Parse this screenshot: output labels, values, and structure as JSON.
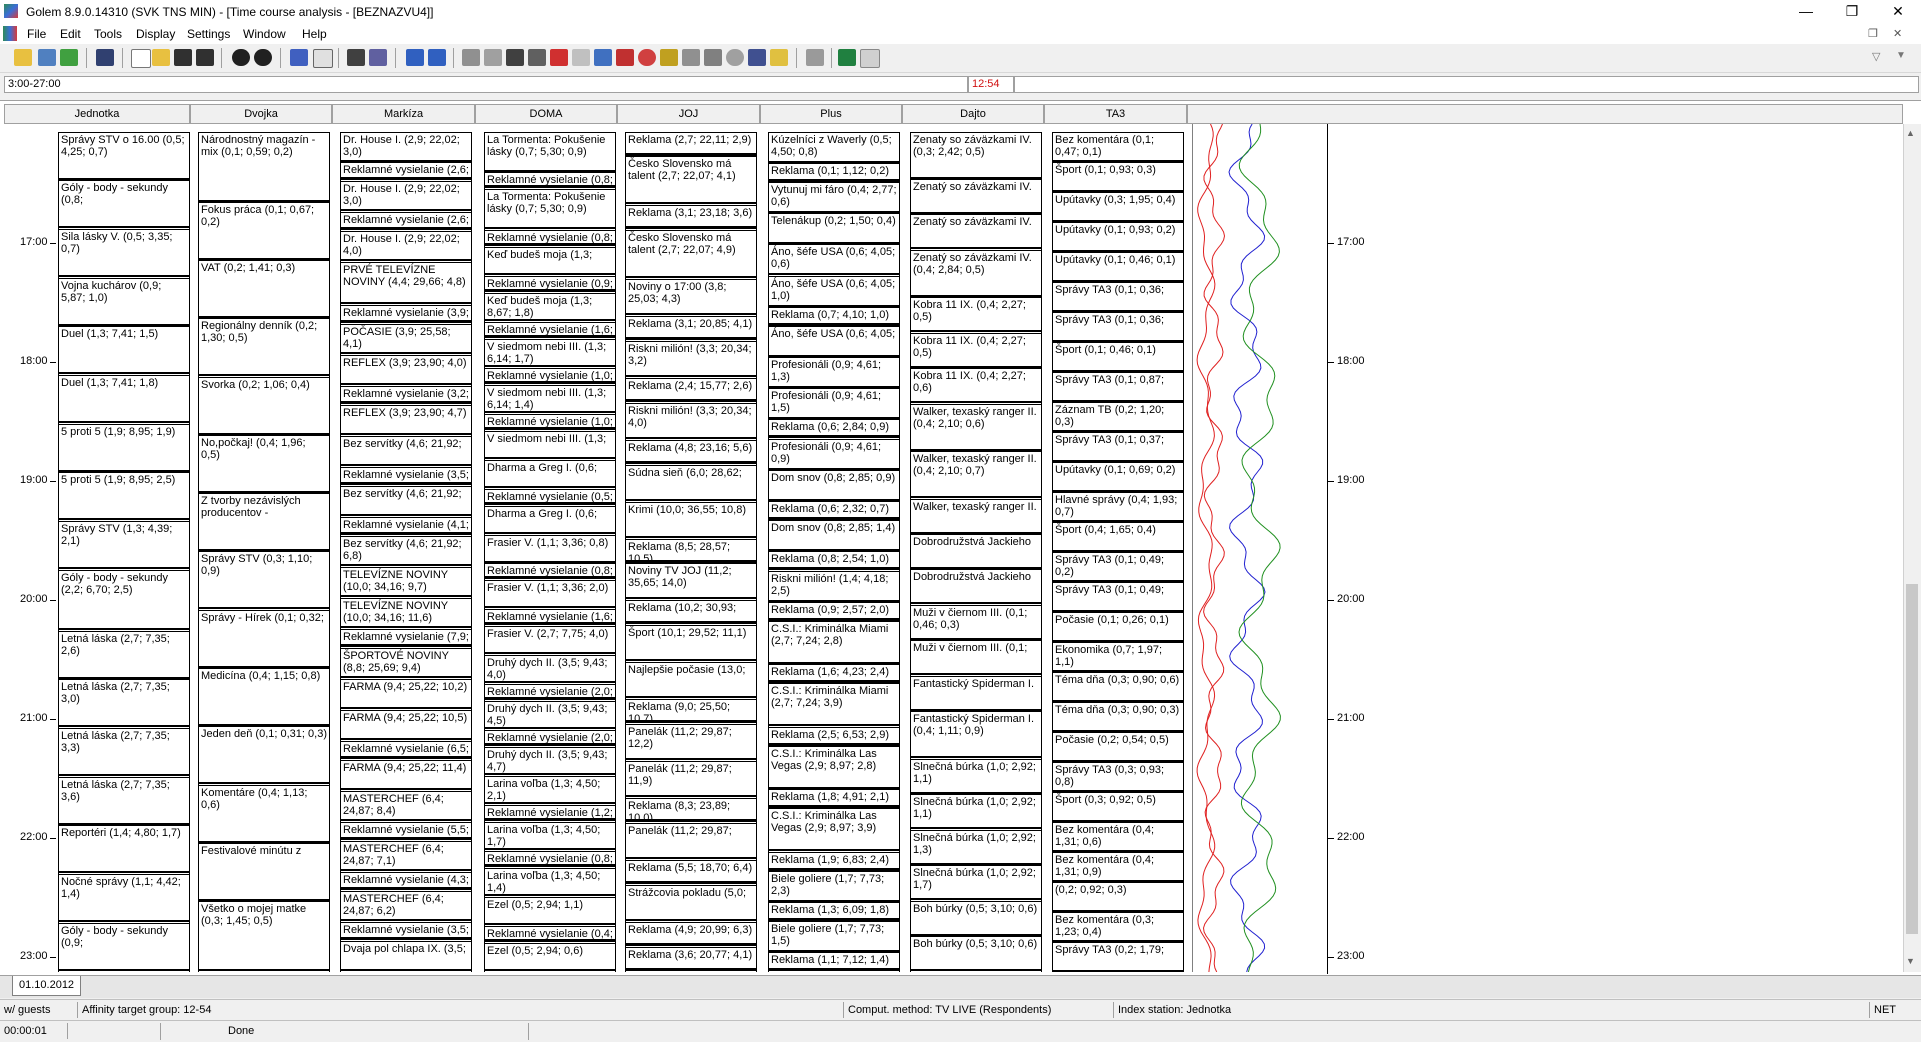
{
  "window": {
    "title": "Golem 8.9.0.14310 (SVK TNS MIN) - [Time course analysis - [BEZNAZVU4]]",
    "minimize": "—",
    "restore": "❐",
    "close": "✕"
  },
  "menu": [
    "File",
    "Edit",
    "Tools",
    "Display",
    "Settings",
    "Window",
    "Help"
  ],
  "range": {
    "left_value": "3:00-27:00",
    "mid_value": "12:54"
  },
  "channels": [
    "Jednotka",
    "Dvojka",
    "Markíza",
    "DOMA",
    "JOJ",
    "Plus",
    "Dajto",
    "TA3"
  ],
  "time_labels": [
    "17:00",
    "18:00",
    "19:00",
    "20:00",
    "21:00",
    "22:00",
    "23:00"
  ],
  "columns": {
    "jednotka": [
      "Správy STV o 16.00 (0,5; 4,25; 0,7)",
      "Góly - body - sekundy (0,8;",
      "Sila lásky V. (0,5; 3,35; 0,7)",
      "Vojna kuchárov (0,9; 5,87; 1,0)",
      "Duel (1,3; 7,41; 1,5)",
      "Duel (1,3; 7,41; 1,8)",
      "5 proti 5 (1,9; 8,95; 1,9)",
      "5 proti 5 (1,9; 8,95; 2,5)",
      "Správy STV (1,3; 4,39; 2,1)",
      "Góly - body - sekundy (2,2; 6,70; 2,5)",
      "Letná láska (2,7; 7,35; 2,6)",
      "Letná láska (2,7; 7,35; 3,0)",
      "Letná láska (2,7; 7,35; 3,3)",
      "Letná láska (2,7; 7,35; 3,6)",
      "Reportéri (1,4; 4,80; 1,7)",
      "Nočné správy (1,1; 4,42; 1,4)",
      "Góly - body - sekundy (0,9;"
    ],
    "dvojka": [
      "Národnostný magazín - mix (0,1; 0,59; 0,2)",
      "Fokus práca (0,1; 0,67; 0,2)",
      "VAT (0,2; 1,41; 0,3)",
      "Regionálny denník (0,2; 1,30; 0,5)",
      "Svorka (0,2; 1,06; 0,4)",
      "No,počkaj! (0,4; 1,96; 0,5)",
      "Z tvorby nezávislých producentov -",
      "Správy STV (0,3; 1,10; 0,9)",
      "Správy - Hírek (0,1; 0,32;",
      "Medicína (0,4; 1,15; 0,8)",
      "Jeden deň (0,1; 0,31; 0,3)",
      "Komentáre (0,4; 1,13; 0,6)",
      "Festivalové minútu z",
      "Všetko o mojej matke (0,3; 1,45; 0,5)"
    ],
    "markiza": [
      "Dr. House I. (2,9; 22,02; 3,0)",
      "Reklamné vysielanie (2,6;",
      "Dr. House I. (2,9; 22,02; 3,0)",
      "Reklamné vysielanie (2,6;",
      "Dr. House I. (2,9; 22,02; 4,0)",
      "PRVÉ TELEVÍZNE NOVINY (4,4; 29,66; 4,8)",
      "Reklamné vysielanie (3,9;",
      "POČASIE (3,9; 25,58; 4,1)",
      "REFLEX (3,9; 23,90; 4,0)",
      "Reklamné vysielanie (3,2;",
      "REFLEX (3,9; 23,90; 4,7)",
      "Bez servítky (4,6; 21,92;",
      "Reklamné vysielanie (3,5;",
      "Bez servítky (4,6; 21,92;",
      "Reklamné vysielanie (4,1;",
      "Bez servítky (4,6; 21,92; 6,8)",
      "TELEVÍZNE NOVINY (10,0; 34,16; 9,7)",
      "TELEVÍZNE NOVINY (10,0; 34,16; 11,6)",
      "Reklamné vysielanie (7,9;",
      "ŠPORTOVÉ NOVINY (8,8; 25,69; 9,4)",
      "FARMA (9,4; 25,22; 10,2)",
      "FARMA (9,4; 25,22; 10,5)",
      "Reklamné vysielanie (6,5;",
      "FARMA (9,4; 25,22; 11,4)",
      "MASTERCHEF (6,4; 24,87; 8,4)",
      "Reklamné vysielanie (5,5;",
      "MASTERCHEF (6,4; 24,87; 7,1)",
      "Reklamné vysielanie (4,3;",
      "MASTERCHEF (6,4; 24,87; 6,2)",
      "Reklamné vysielanie (3,5;",
      "Dvaja pol chlapa IX. (3,5;"
    ],
    "doma": [
      "La Tormenta: Pokušenie lásky (0,7; 5,30; 0,9)",
      "Reklamné vysielanie (0,8;",
      "La Tormenta: Pokušenie lásky (0,7; 5,30; 0,9)",
      "Reklamné vysielanie (0,8;",
      "Keď budeš moja (1,3;",
      "Reklamné vysielanie (0,9;",
      "Keď budeš moja (1,3; 8,67; 1,8)",
      "Reklamné vysielanie (1,6;",
      "V siedmom nebi III. (1,3; 6,14; 1,7)",
      "Reklamné vysielanie (1,0;",
      "V siedmom nebi III. (1,3; 6,14; 1,4)",
      "Reklamné vysielanie (1,0;",
      "V siedmom nebi III. (1,3;",
      "Dharma a Greg I. (0,6;",
      "Reklamné vysielanie (0,5;",
      "Dharma a Greg I. (0,6;",
      "Frasier V. (1,1; 3,36; 0,8)",
      "Reklamné vysielanie (0,8;",
      "Frasier V. (1,1; 3,36; 2,0)",
      "Reklamné vysielanie (1,6;",
      "Frasier V. (2,7; 7,75; 4,0)",
      "Druhý dych II. (3,5; 9,43; 4,0)",
      "Reklamné vysielanie (2,0;",
      "Druhý dych II. (3,5; 9,43; 4,5)",
      "Reklamné vysielanie (2,0;",
      "Druhý dych II. (3,5; 9,43; 4,7)",
      "Larina voľba (1,3; 4,50; 2,1)",
      "Reklamné vysielanie (1,2;",
      "Larina voľba (1,3; 4,50; 1,7)",
      "Reklamné vysielanie (0,8;",
      "Larina voľba (1,3; 4,50; 1,4)",
      "Ezel (0,5; 2,94; 1,1)",
      "Reklamné vysielanie (0,4;",
      "Ezel (0,5; 2,94; 0,6)"
    ],
    "joj": [
      "Reklama (2,7; 22,11; 2,9)",
      "Česko Slovensko má talent (2,7; 22,07; 4,1)",
      "Reklama (3,1; 23,18; 3,6)",
      "Česko Slovensko má talent (2,7; 22,07; 4,9)",
      "Noviny o 17:00 (3,8; 25,03; 4,3)",
      "Reklama (3,1; 20,85; 4,1)",
      "Riskni milión! (3,3; 20,34; 3,2)",
      "Reklama (2,4; 15,77; 2,6)",
      "Riskni milión! (3,3; 20,34; 4,0)",
      "Reklama (4,8; 23,16; 5,6)",
      "Súdna sieň (6,0; 28,62;",
      "Krimi (10,0; 36,55; 10,8)",
      "Reklama (8,5; 28,57; 10,5)",
      "Noviny TV JOJ (11,2; 35,65; 14,0)",
      "Reklama (10,2; 30,93;",
      "Šport (10,1; 29,52; 11,1)",
      "Najlepšie počasie (13,0;",
      "Reklama (9,0; 25,50; 10,7)",
      "Panelák (11,2; 29,87; 12,2)",
      "Panelák (11,2; 29,87; 11,9)",
      "Reklama (8,3; 23,89; 10,0)",
      "Panelák (11,2; 29,87;",
      "Reklama (5,5; 18,70; 6,4)",
      "Strážcovia pokladu (5,0;",
      "Reklama (4,9; 20,99; 6,3)",
      "Reklama (3,6; 20,77; 4,1)"
    ],
    "plus": [
      "Kúzelníci z Waverly (0,5; 4,50; 0,8)",
      "Reklama (0,1; 1,12; 0,2)",
      "Vytunuj mi fáro (0,4; 2,77; 0,6)",
      "Telenákup (0,2; 1,50; 0,4)",
      "Áno, šéfe USA (0,6; 4,05; 0,6)",
      "Áno, šéfe USA (0,6; 4,05; 1,0)",
      "Reklama (0,7; 4,10; 1,0)",
      "Áno, šéfe USA (0,6; 4,05;",
      "Profesionáli (0,9; 4,61; 1,3)",
      "Profesionáli (0,9; 4,61; 1,5)",
      "Reklama (0,6; 2,84; 0,9)",
      "Profesionáli (0,9; 4,61; 0,9)",
      "Dom snov (0,8; 2,85; 0,9)",
      "Reklama (0,6; 2,32; 0,7)",
      "Dom snov (0,8; 2,85; 1,4)",
      "Reklama (0,8; 2,54; 1,0)",
      "Riskni milión! (1,4; 4,18; 2,5)",
      "Reklama (0,9; 2,57; 2,0)",
      "C.S.I.: Kriminálka Miami (2,7; 7,24; 2,8)",
      "Reklama (1,6; 4,23; 2,4)",
      "C.S.I.: Kriminálka Miami (2,7; 7,24; 3,9)",
      "Reklama (2,5; 6,53; 2,9)",
      "C.S.I.: Kriminálka Las Vegas (2,9; 8,97; 2,8)",
      "Reklama (1,8; 4,91; 2,1)",
      "C.S.I.: Kriminálka Las Vegas (2,9; 8,97; 3,9)",
      "Reklama (1,9; 6,83; 2,4)",
      "Biele goliere (1,7; 7,73; 2,3)",
      "Reklama (1,3; 6,09; 1,8)",
      "Biele goliere (1,7; 7,73; 1,5)",
      "Reklama (1,1; 7,12; 1,4)"
    ],
    "dajto": [
      "Zenaty so záväzkami IV. (0,3; 2,42; 0,5)",
      "Zenatý so záväzkami IV.",
      "Zenatý so záväzkami IV.",
      "Zenatý so záväzkami IV. (0,4; 2,84; 0,5)",
      "Kobra 11 IX. (0,4; 2,27; 0,5)",
      "Kobra 11 IX. (0,4; 2,27; 0,5)",
      "Kobra 11 IX. (0,4; 2,27; 0,6)",
      "Walker, texaský ranger II. (0,4; 2,10; 0,6)",
      "Walker, texaský ranger II. (0,4; 2,10; 0,7)",
      "Walker, texaský ranger II.",
      "Dobrodružstvá Jackieho",
      "Dobrodružstvá Jackieho",
      "Muži v čiernom III. (0,1; 0,46; 0,3)",
      "Muži v čiernom III. (0,1;",
      "Fantastický Spiderman I.",
      "Fantastický Spiderman I. (0,4; 1,11; 0,9)",
      "Slnečná búrka (1,0; 2,92; 1,1)",
      "Slnečná búrka (1,0; 2,92; 1,1)",
      "Slnečná búrka (1,0; 2,92; 1,3)",
      "Slnečná búrka (1,0; 2,92; 1,7)",
      "Boh búrky (0,5; 3,10; 0,6)",
      "Boh búrky (0,5; 3,10; 0,6)"
    ],
    "ta3": [
      "Bez komentára (0,1; 0,47; 0,1)",
      "Šport (0,1; 0,93; 0,3)",
      "Upútavky (0,3; 1,95; 0,4)",
      "Upútavky (0,1; 0,93; 0,2)",
      "Upútavky (0,1; 0,46; 0,1)",
      "Správy TA3 (0,1; 0,36;",
      "Správy TA3 (0,1; 0,36;",
      "Šport (0,1; 0,46; 0,1)",
      "Správy TA3 (0,1; 0,87;",
      "Záznam TB (0,2; 1,20; 0,3)",
      "Správy TA3 (0,1; 0,37;",
      "Upútavky (0,1; 0,69; 0,2)",
      "Hlavné správy (0,4; 1,93; 0,7)",
      "Šport (0,4; 1,65; 0,4)",
      "Správy TA3 (0,1; 0,49; 0,2)",
      "Správy TA3 (0,1; 0,49;",
      "Počasie (0,1; 0,26; 0,1)",
      "Ekonomika (0,7; 1,97; 1,1)",
      "Téma dňa (0,3; 0,90; 0,6)",
      "Téma dňa (0,3; 0,90; 0,3)",
      "Počasie (0,2; 0,54; 0,5)",
      "Správy TA3 (0,3; 0,93; 0,8)",
      "Šport (0,3; 0,92; 0,5)",
      "Bez komentára (0,4; 1,31; 0,6)",
      "Bez komentára (0,4; 1,31; 0,9)",
      "(0,2; 0,92; 0,3)",
      "Bez komentára (0,3; 1,23; 0,4)",
      "Správy TA3 (0,2; 1,79;"
    ]
  },
  "tab": {
    "label": "01.10.2012"
  },
  "status1": {
    "c1": "w/ guests",
    "c2": "Affinity target group: 12-54",
    "c3": "Comput. method: TV LIVE (Respondents)",
    "c4": "Index station: Jednotka",
    "c5": "NET"
  },
  "status2": {
    "time": "00:00:01",
    "state": "Done"
  },
  "colors": {
    "curve_red": "#e02020",
    "curve_blue": "#2020d0",
    "curve_green": "#209020",
    "shade": "#c0c0c0"
  }
}
